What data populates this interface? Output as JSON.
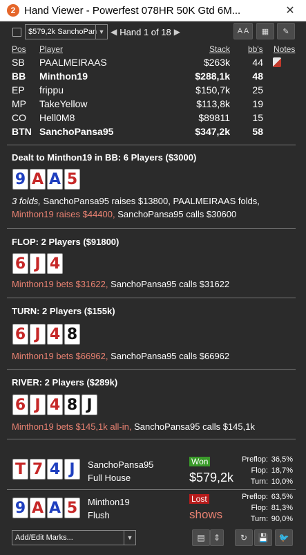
{
  "window": {
    "title": "Hand Viewer - Powerfest 078HR 50K Gtd 6M...",
    "close": "✕"
  },
  "toolbar": {
    "hand_select": "$579,2k SanchoPan",
    "hand_counter": "Hand 1 of 18",
    "btn_font": "A A",
    "btn_grid": "▦",
    "btn_edit": "✎"
  },
  "players": {
    "headers": {
      "pos": "Pos",
      "player": "Player",
      "stack": "Stack",
      "bbs": "bb's",
      "notes": "Notes"
    },
    "rows": [
      {
        "pos": "SB",
        "name": "PAALMEIRAAS",
        "stack": "$263k",
        "bbs": "44",
        "bold": false
      },
      {
        "pos": "BB",
        "name": "Minthon19",
        "stack": "$288,1k",
        "bbs": "48",
        "bold": true
      },
      {
        "pos": "EP",
        "name": "frippu",
        "stack": "$150,7k",
        "bbs": "25",
        "bold": false
      },
      {
        "pos": "MP",
        "name": "TakeYellow",
        "stack": "$113,8k",
        "bbs": "19",
        "bold": false
      },
      {
        "pos": "CO",
        "name": "Hell0M8",
        "stack": "$89811",
        "bbs": "15",
        "bold": false
      },
      {
        "pos": "BTN",
        "name": "SanchoPansa95",
        "stack": "$347,2k",
        "bbs": "58",
        "bold": true
      }
    ]
  },
  "preflop": {
    "title": "Dealt to Minthon19 in BB: 6 Players ($3000)",
    "cards": [
      {
        "rank": "9",
        "color": "#1f3fbf"
      },
      {
        "rank": "A",
        "color": "#c62828"
      },
      {
        "rank": "A",
        "color": "#1f3fbf"
      },
      {
        "rank": "5",
        "color": "#c62828"
      }
    ],
    "line1_folds": "3 folds,",
    "line1_rest": " SanchoPansa95 raises $13800, PAALMEIRAAS folds,",
    "line2_hero": "Minthon19 raises $44400,",
    "line2_rest": " SanchoPansa95 calls $30600"
  },
  "flop": {
    "title": "FLOP: 2 Players ($91800)",
    "cards": [
      {
        "rank": "6",
        "color": "#c62828"
      },
      {
        "rank": "J",
        "color": "#c62828"
      },
      {
        "rank": "4",
        "color": "#c62828"
      }
    ],
    "hero": "Minthon19 bets $31622,",
    "rest": " SanchoPansa95 calls $31622"
  },
  "turn": {
    "title": "TURN: 2 Players ($155k)",
    "cards": [
      {
        "rank": "6",
        "color": "#c62828"
      },
      {
        "rank": "J",
        "color": "#c62828"
      },
      {
        "rank": "4",
        "color": "#c62828"
      },
      {
        "rank": "8",
        "color": "#111111"
      }
    ],
    "hero": "Minthon19 bets $66962,",
    "rest": " SanchoPansa95 calls $66962"
  },
  "river": {
    "title": "RIVER: 2 Players ($289k)",
    "cards": [
      {
        "rank": "6",
        "color": "#c62828"
      },
      {
        "rank": "J",
        "color": "#c62828"
      },
      {
        "rank": "4",
        "color": "#c62828"
      },
      {
        "rank": "8",
        "color": "#111111"
      },
      {
        "rank": "J",
        "color": "#111111"
      }
    ],
    "hero": "Minthon19 bets $145,1k all-in,",
    "rest": " SanchoPansa95 calls $145,1k"
  },
  "results": [
    {
      "cards": [
        {
          "rank": "T",
          "color": "#c62828"
        },
        {
          "rank": "7",
          "color": "#c62828"
        },
        {
          "rank": "4",
          "color": "#1f3fbf"
        },
        {
          "rank": "J",
          "color": "#1f3fbf"
        }
      ],
      "name": "SanchoPansa95",
      "hand": "Full House",
      "badge": "Won",
      "amount": "$579,2k",
      "stats": [
        {
          "label": "Preflop:",
          "value": "36,5%"
        },
        {
          "label": "Flop:",
          "value": "18,7%"
        },
        {
          "label": "Turn:",
          "value": "10,0%"
        }
      ]
    },
    {
      "cards": [
        {
          "rank": "9",
          "color": "#1f3fbf"
        },
        {
          "rank": "A",
          "color": "#c62828"
        },
        {
          "rank": "A",
          "color": "#1f3fbf"
        },
        {
          "rank": "5",
          "color": "#c62828"
        }
      ],
      "name": "Minthon19",
      "hand": "Flush",
      "badge": "Lost",
      "amount": "shows",
      "stats": [
        {
          "label": "Preflop:",
          "value": "63,5%"
        },
        {
          "label": "Flop:",
          "value": "81,3%"
        },
        {
          "label": "Turn:",
          "value": "90,0%"
        }
      ]
    }
  ],
  "bottom": {
    "marks_placeholder": "Add/Edit Marks...",
    "btn_notes": "▤",
    "btn_updown": "⇕",
    "btn_refresh": "↻",
    "btn_save": "💾",
    "btn_twitter": "🐦"
  }
}
